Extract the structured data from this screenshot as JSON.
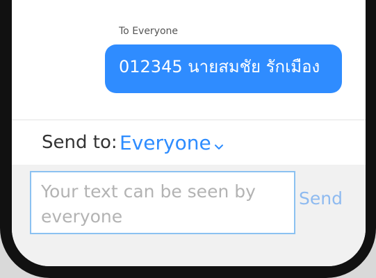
{
  "chat": {
    "audience_label": "To Everyone",
    "message_text": "012345 นายสมชัย รักเมือง"
  },
  "recipient_bar": {
    "label": "Send to:",
    "selected_value": "Everyone"
  },
  "composer": {
    "placeholder": "Your text can be seen by everyone",
    "send_label": "Send"
  },
  "icons": {
    "dropdown": "chevron-down-icon"
  },
  "colors": {
    "accent": "#2d8cff",
    "bubble": "#2f8cff",
    "input_border": "#8bc1f1",
    "placeholder": "#b3b3b3",
    "send_disabled": "#8ebaf0"
  }
}
